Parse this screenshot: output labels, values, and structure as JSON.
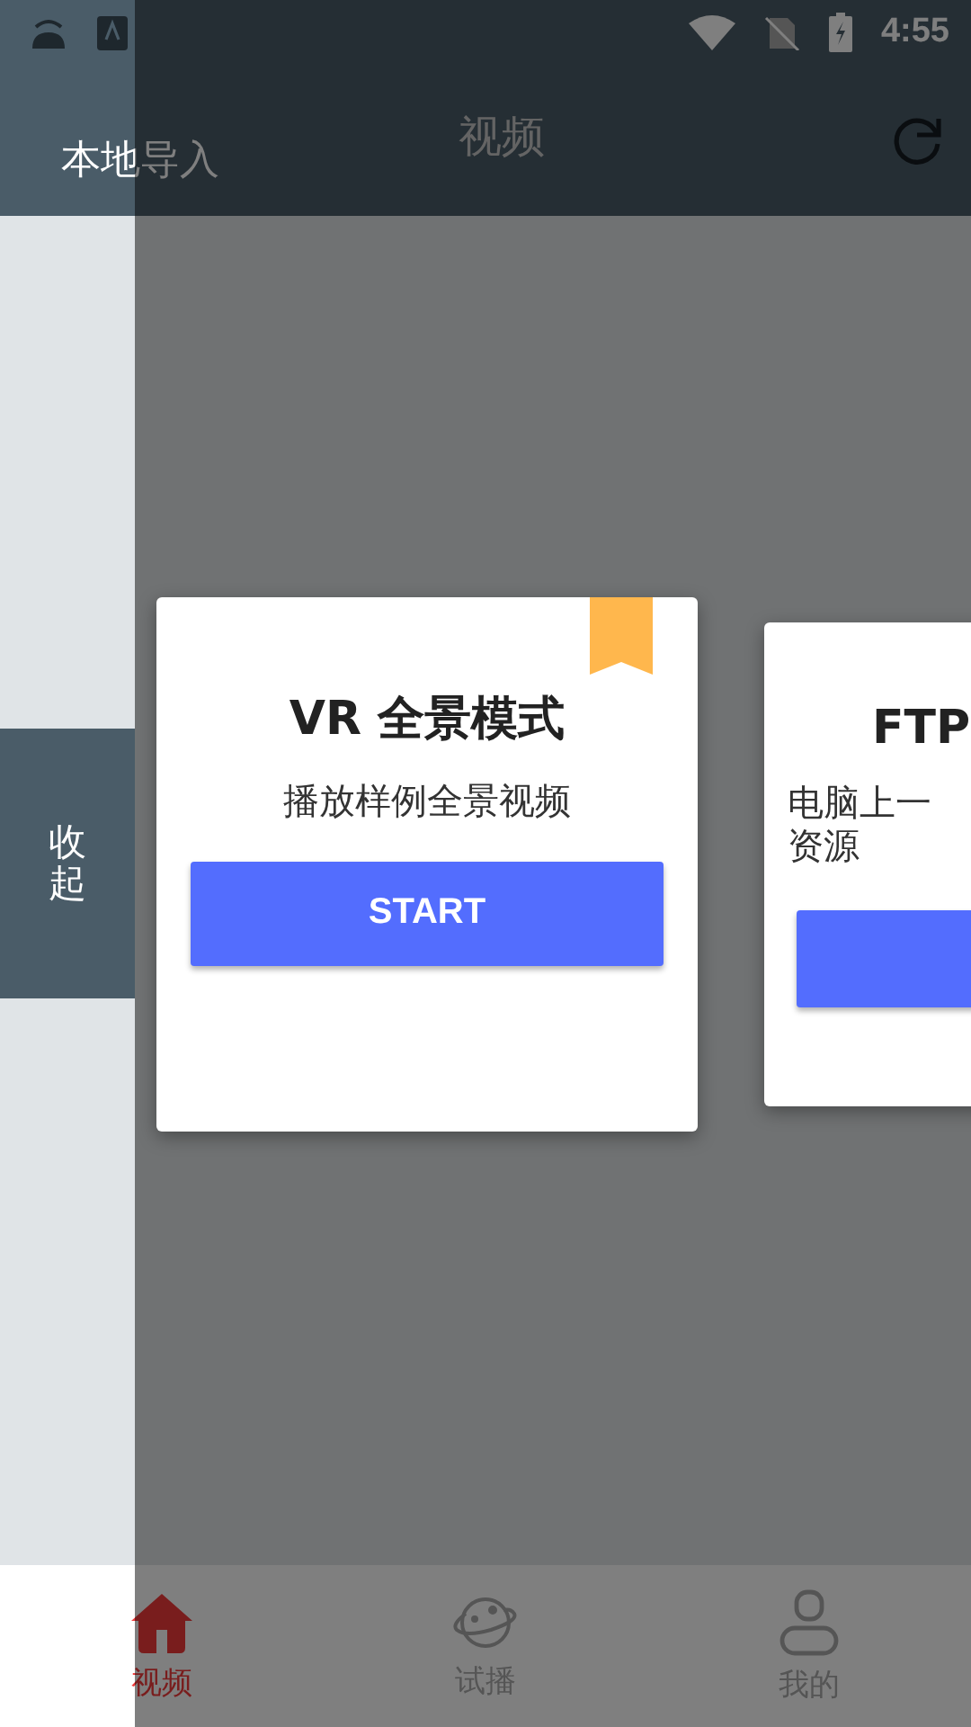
{
  "status_bar": {
    "time": "4:55"
  },
  "header": {
    "side_label": "本地导入",
    "title": "视频"
  },
  "side_tab": {
    "label": "收起"
  },
  "cards": [
    {
      "title": "VR 全景模式",
      "lines": [
        "播放样例全景视频"
      ],
      "button": "START",
      "bookmarked": true
    },
    {
      "title": "FTP",
      "lines": [
        "电脑上一",
        "资源"
      ]
    }
  ],
  "bottom_nav": [
    {
      "kind": "home",
      "label": "视频",
      "selected": true
    },
    {
      "kind": "planet",
      "label": "试播",
      "selected": false
    },
    {
      "kind": "person",
      "label": "我的",
      "selected": false
    }
  ]
}
